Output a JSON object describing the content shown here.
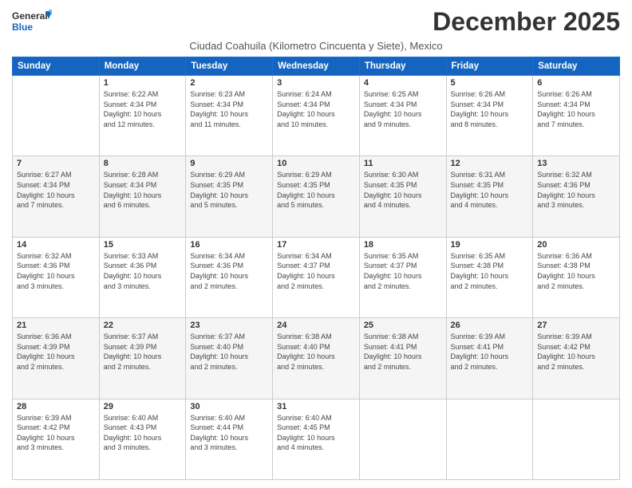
{
  "logo": {
    "line1": "General",
    "line2": "Blue"
  },
  "title": "December 2025",
  "subtitle": "Ciudad Coahuila (Kilometro Cincuenta y Siete), Mexico",
  "days_of_week": [
    "Sunday",
    "Monday",
    "Tuesday",
    "Wednesday",
    "Thursday",
    "Friday",
    "Saturday"
  ],
  "weeks": [
    [
      {
        "num": "",
        "info": ""
      },
      {
        "num": "1",
        "info": "Sunrise: 6:22 AM\nSunset: 4:34 PM\nDaylight: 10 hours\nand 12 minutes."
      },
      {
        "num": "2",
        "info": "Sunrise: 6:23 AM\nSunset: 4:34 PM\nDaylight: 10 hours\nand 11 minutes."
      },
      {
        "num": "3",
        "info": "Sunrise: 6:24 AM\nSunset: 4:34 PM\nDaylight: 10 hours\nand 10 minutes."
      },
      {
        "num": "4",
        "info": "Sunrise: 6:25 AM\nSunset: 4:34 PM\nDaylight: 10 hours\nand 9 minutes."
      },
      {
        "num": "5",
        "info": "Sunrise: 6:26 AM\nSunset: 4:34 PM\nDaylight: 10 hours\nand 8 minutes."
      },
      {
        "num": "6",
        "info": "Sunrise: 6:26 AM\nSunset: 4:34 PM\nDaylight: 10 hours\nand 7 minutes."
      }
    ],
    [
      {
        "num": "7",
        "info": "Sunrise: 6:27 AM\nSunset: 4:34 PM\nDaylight: 10 hours\nand 7 minutes."
      },
      {
        "num": "8",
        "info": "Sunrise: 6:28 AM\nSunset: 4:34 PM\nDaylight: 10 hours\nand 6 minutes."
      },
      {
        "num": "9",
        "info": "Sunrise: 6:29 AM\nSunset: 4:35 PM\nDaylight: 10 hours\nand 5 minutes."
      },
      {
        "num": "10",
        "info": "Sunrise: 6:29 AM\nSunset: 4:35 PM\nDaylight: 10 hours\nand 5 minutes."
      },
      {
        "num": "11",
        "info": "Sunrise: 6:30 AM\nSunset: 4:35 PM\nDaylight: 10 hours\nand 4 minutes."
      },
      {
        "num": "12",
        "info": "Sunrise: 6:31 AM\nSunset: 4:35 PM\nDaylight: 10 hours\nand 4 minutes."
      },
      {
        "num": "13",
        "info": "Sunrise: 6:32 AM\nSunset: 4:36 PM\nDaylight: 10 hours\nand 3 minutes."
      }
    ],
    [
      {
        "num": "14",
        "info": "Sunrise: 6:32 AM\nSunset: 4:36 PM\nDaylight: 10 hours\nand 3 minutes."
      },
      {
        "num": "15",
        "info": "Sunrise: 6:33 AM\nSunset: 4:36 PM\nDaylight: 10 hours\nand 3 minutes."
      },
      {
        "num": "16",
        "info": "Sunrise: 6:34 AM\nSunset: 4:36 PM\nDaylight: 10 hours\nand 2 minutes."
      },
      {
        "num": "17",
        "info": "Sunrise: 6:34 AM\nSunset: 4:37 PM\nDaylight: 10 hours\nand 2 minutes."
      },
      {
        "num": "18",
        "info": "Sunrise: 6:35 AM\nSunset: 4:37 PM\nDaylight: 10 hours\nand 2 minutes."
      },
      {
        "num": "19",
        "info": "Sunrise: 6:35 AM\nSunset: 4:38 PM\nDaylight: 10 hours\nand 2 minutes."
      },
      {
        "num": "20",
        "info": "Sunrise: 6:36 AM\nSunset: 4:38 PM\nDaylight: 10 hours\nand 2 minutes."
      }
    ],
    [
      {
        "num": "21",
        "info": "Sunrise: 6:36 AM\nSunset: 4:39 PM\nDaylight: 10 hours\nand 2 minutes."
      },
      {
        "num": "22",
        "info": "Sunrise: 6:37 AM\nSunset: 4:39 PM\nDaylight: 10 hours\nand 2 minutes."
      },
      {
        "num": "23",
        "info": "Sunrise: 6:37 AM\nSunset: 4:40 PM\nDaylight: 10 hours\nand 2 minutes."
      },
      {
        "num": "24",
        "info": "Sunrise: 6:38 AM\nSunset: 4:40 PM\nDaylight: 10 hours\nand 2 minutes."
      },
      {
        "num": "25",
        "info": "Sunrise: 6:38 AM\nSunset: 4:41 PM\nDaylight: 10 hours\nand 2 minutes."
      },
      {
        "num": "26",
        "info": "Sunrise: 6:39 AM\nSunset: 4:41 PM\nDaylight: 10 hours\nand 2 minutes."
      },
      {
        "num": "27",
        "info": "Sunrise: 6:39 AM\nSunset: 4:42 PM\nDaylight: 10 hours\nand 2 minutes."
      }
    ],
    [
      {
        "num": "28",
        "info": "Sunrise: 6:39 AM\nSunset: 4:42 PM\nDaylight: 10 hours\nand 3 minutes."
      },
      {
        "num": "29",
        "info": "Sunrise: 6:40 AM\nSunset: 4:43 PM\nDaylight: 10 hours\nand 3 minutes."
      },
      {
        "num": "30",
        "info": "Sunrise: 6:40 AM\nSunset: 4:44 PM\nDaylight: 10 hours\nand 3 minutes."
      },
      {
        "num": "31",
        "info": "Sunrise: 6:40 AM\nSunset: 4:45 PM\nDaylight: 10 hours\nand 4 minutes."
      },
      {
        "num": "",
        "info": ""
      },
      {
        "num": "",
        "info": ""
      },
      {
        "num": "",
        "info": ""
      }
    ]
  ]
}
